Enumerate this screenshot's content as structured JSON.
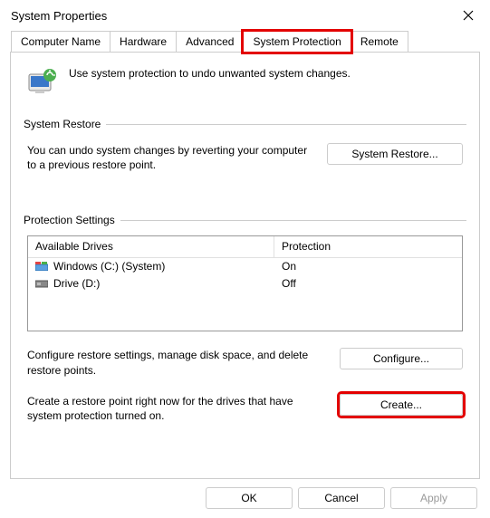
{
  "title": "System Properties",
  "tabs": [
    "Computer Name",
    "Hardware",
    "Advanced",
    "System Protection",
    "Remote"
  ],
  "selected_tab_index": 3,
  "intro_text": "Use system protection to undo unwanted system changes.",
  "restore": {
    "group_title": "System Restore",
    "desc": "You can undo system changes by reverting your computer to a previous restore point.",
    "button": "System Restore..."
  },
  "protection": {
    "group_title": "Protection Settings",
    "headers": {
      "drives": "Available Drives",
      "protection": "Protection"
    },
    "rows": [
      {
        "icon": "win-drive",
        "name": "Windows (C:) (System)",
        "state": "On"
      },
      {
        "icon": "drive",
        "name": "Drive (D:)",
        "state": "Off"
      }
    ],
    "configure": {
      "desc": "Configure restore settings, manage disk space, and delete restore points.",
      "button": "Configure..."
    },
    "create": {
      "desc": "Create a restore point right now for the drives that have system protection turned on.",
      "button": "Create..."
    }
  },
  "footer": {
    "ok": "OK",
    "cancel": "Cancel",
    "apply": "Apply"
  },
  "highlight": {
    "tab_index": 3,
    "create_button": true
  }
}
